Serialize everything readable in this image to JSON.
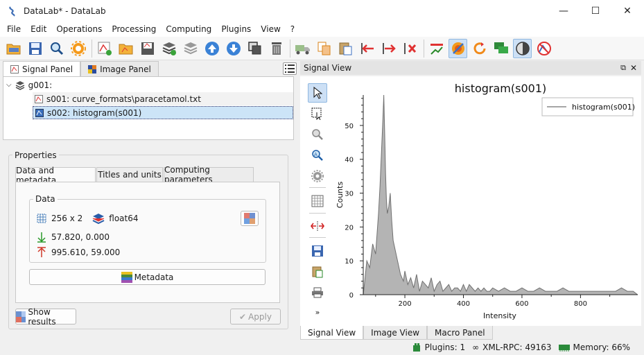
{
  "window": {
    "title": "DataLab* - DataLab",
    "minimize": "—",
    "maximize": "☐",
    "close": "✕"
  },
  "menu": [
    "File",
    "Edit",
    "Operations",
    "Processing",
    "Computing",
    "Plugins",
    "View",
    "?"
  ],
  "toolbar_icons": [
    "open-folder-icon",
    "save-icon",
    "zoom-find-icon",
    "settings-icon",
    "new-signal-icon",
    "open-signal-icon",
    "save-signal-icon",
    "new-group-icon",
    "layers-icon",
    "move-up-icon",
    "move-down-icon",
    "duplicate-icon",
    "delete-icon",
    "truck-icon",
    "copy-icon",
    "paste-icon",
    "import-icon",
    "export-icon",
    "remove-icon",
    "plot-icon",
    "stop-icon",
    "refresh-icon",
    "chat-icon",
    "contrast-icon",
    "no-signal-icon"
  ],
  "left_tabs": [
    {
      "label": "Signal Panel",
      "active": true
    },
    {
      "label": "Image Panel",
      "active": false
    }
  ],
  "tree": {
    "group": "g001:",
    "items": [
      {
        "label": "s001: curve_formats\\paracetamol.txt",
        "selected": false
      },
      {
        "label": "s002: histogram(s001)",
        "selected": true
      }
    ]
  },
  "properties": {
    "title": "Properties",
    "tabs": [
      {
        "label": "Data and metadata",
        "active": true
      },
      {
        "label": "Titles and units",
        "active": false
      },
      {
        "label": "Computing parameters",
        "active": false
      }
    ],
    "data_label": "Data",
    "shape": "256 x 2",
    "dtype": "float64",
    "xmin_ymin": "57.820, 0.000",
    "xmax_ymax": "995.610, 59.000",
    "metadata_button": "Metadata",
    "show_results_button": "Show results",
    "apply_button": "Apply"
  },
  "dock": {
    "title": "Signal View"
  },
  "bottom_tabs": [
    {
      "label": "Signal View",
      "active": true
    },
    {
      "label": "Image View",
      "active": false
    },
    {
      "label": "Macro Panel",
      "active": false
    }
  ],
  "status": {
    "plugins": "Plugins: 1",
    "xmlrpc": "XML-RPC: 49163",
    "memory": "Memory: 66%"
  },
  "colors": {
    "accent": "#cce4f7",
    "fill": "#b4b4b4",
    "line": "#707070"
  },
  "chart_data": {
    "type": "area",
    "title": "histogram(s001)",
    "xlabel": "Intensity",
    "ylabel": "Counts",
    "xlim": [
      57.82,
      995.61
    ],
    "ylim": [
      0,
      59
    ],
    "xticks": [
      200,
      400,
      600,
      800
    ],
    "yticks": [
      0,
      10,
      20,
      30,
      40,
      50
    ],
    "legend_position": "top-right",
    "series": [
      {
        "name": "histogram(s001)",
        "x": [
          58,
          70,
          80,
          90,
          100,
          105,
          110,
          115,
          120,
          125,
          128,
          131,
          134,
          137,
          140,
          145,
          150,
          155,
          160,
          165,
          170,
          175,
          180,
          185,
          190,
          195,
          200,
          210,
          220,
          230,
          240,
          250,
          260,
          270,
          280,
          290,
          300,
          310,
          320,
          330,
          340,
          350,
          360,
          370,
          380,
          390,
          400,
          410,
          420,
          430,
          440,
          450,
          460,
          470,
          480,
          490,
          500,
          520,
          540,
          560,
          580,
          600,
          620,
          640,
          660,
          680,
          700,
          720,
          740,
          760,
          780,
          800,
          820,
          840,
          860,
          880,
          900,
          920,
          940,
          960,
          980,
          995
        ],
        "y": [
          0,
          10,
          8,
          15,
          12,
          18,
          24,
          32,
          42,
          52,
          59,
          48,
          36,
          28,
          24,
          26,
          30,
          22,
          16,
          14,
          12,
          10,
          8,
          6,
          5,
          4,
          7,
          3,
          5,
          2,
          6,
          1,
          4,
          3,
          2,
          5,
          1,
          3,
          4,
          1,
          2,
          3,
          1,
          2,
          2,
          1,
          3,
          1,
          3,
          2,
          1,
          2,
          1,
          2,
          1,
          1,
          2,
          1,
          2,
          1,
          1,
          2,
          1,
          1,
          2,
          1,
          1,
          1,
          2,
          1,
          1,
          1,
          1,
          1,
          1,
          1,
          1,
          1,
          2,
          1,
          1,
          0
        ]
      }
    ]
  }
}
